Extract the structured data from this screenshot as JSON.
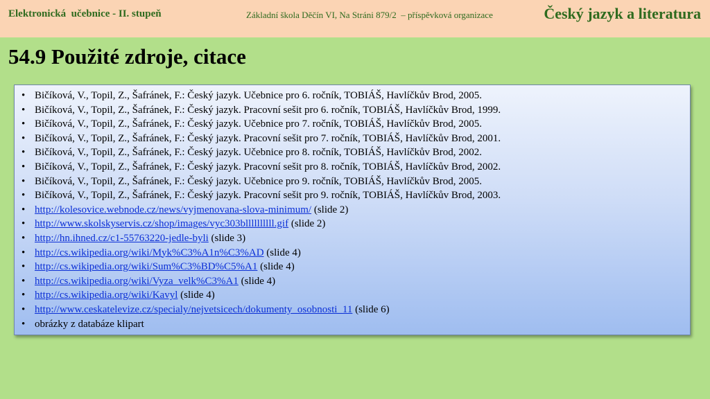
{
  "header": {
    "left": "Elektronická  učebnice - II. stupeň",
    "middle": "Základní škola Děčín VI, Na Stráni 879/2  – příspěvková organizace",
    "right": "Český jazyk a literatura"
  },
  "title": "54.9 Použité zdroje, citace",
  "references": [
    {
      "text": "Bičíková, V., Topil, Z., Šafránek, F.: Český jazyk. Učebnice pro 6. ročník, TOBIÁŠ, Havlíčkův Brod, 2005."
    },
    {
      "text": "Bičíková, V., Topil, Z., Šafránek, F.: Český jazyk. Pracovní sešit pro 6. ročník, TOBIÁŠ, Havlíčkův Brod, 1999."
    },
    {
      "text": "Bičíková, V., Topil, Z., Šafránek, F.: Český jazyk. Učebnice pro 7. ročník, TOBIÁŠ, Havlíčkův Brod, 2005."
    },
    {
      "text": "Bičíková, V., Topil, Z., Šafránek, F.: Český jazyk. Pracovní sešit pro 7. ročník, TOBIÁŠ, Havlíčkův Brod, 2001."
    },
    {
      "text": "Bičíková, V., Topil, Z., Šafránek, F.: Český jazyk. Učebnice pro 8. ročník, TOBIÁŠ, Havlíčkův Brod, 2002."
    },
    {
      "text": "Bičíková, V., Topil, Z., Šafránek, F.: Český jazyk. Pracovní sešit pro 8. ročník, TOBIÁŠ, Havlíčkův Brod, 2002."
    },
    {
      "text": "Bičíková, V., Topil, Z., Šafránek, F.: Český jazyk. Učebnice pro 9. ročník, TOBIÁŠ, Havlíčkův Brod, 2005."
    },
    {
      "text": "Bičíková, V., Topil, Z., Šafránek, F.: Český jazyk. Pracovní sešit pro 9. ročník, TOBIÁŠ, Havlíčkův Brod, 2003."
    }
  ],
  "links": [
    {
      "url": "http://kolesovice.webnode.cz/news/vyjmenovana-slova-minimum/",
      "note": " (slide 2)"
    },
    {
      "url": "http://www.skolskyservis.cz/shop/images/vyc303bllllllllll.gif",
      "note": " (slide 2)"
    },
    {
      "url": "http://hn.ihned.cz/c1-55763220-jedle-byli",
      "note": " (slide 3)"
    },
    {
      "url": "http://cs.wikipedia.org/wiki/Myk%C3%A1n%C3%AD",
      "note": " (slide 4)"
    },
    {
      "url": "http://cs.wikipedia.org/wiki/Sum%C3%BD%C5%A1",
      "note": " (slide 4)"
    },
    {
      "url": "http://cs.wikipedia.org/wiki/Vyza_velk%C3%A1",
      "note": " (slide 4)"
    },
    {
      "url": "http://cs.wikipedia.org/wiki/Kavyl",
      "note": " (slide 4)"
    },
    {
      "url": "http://www.ceskatelevize.cz/specialy/nejvetsicech/dokumenty_osobnosti_11",
      "note": " (slide 6)"
    }
  ],
  "footer_item": "obrázky z databáze klipart",
  "bullet": "•",
  "colors": {
    "background": "#b2df8a",
    "header": "#fbd4b4",
    "header_text": "#2f6b1f",
    "link": "#0b2fd6"
  }
}
